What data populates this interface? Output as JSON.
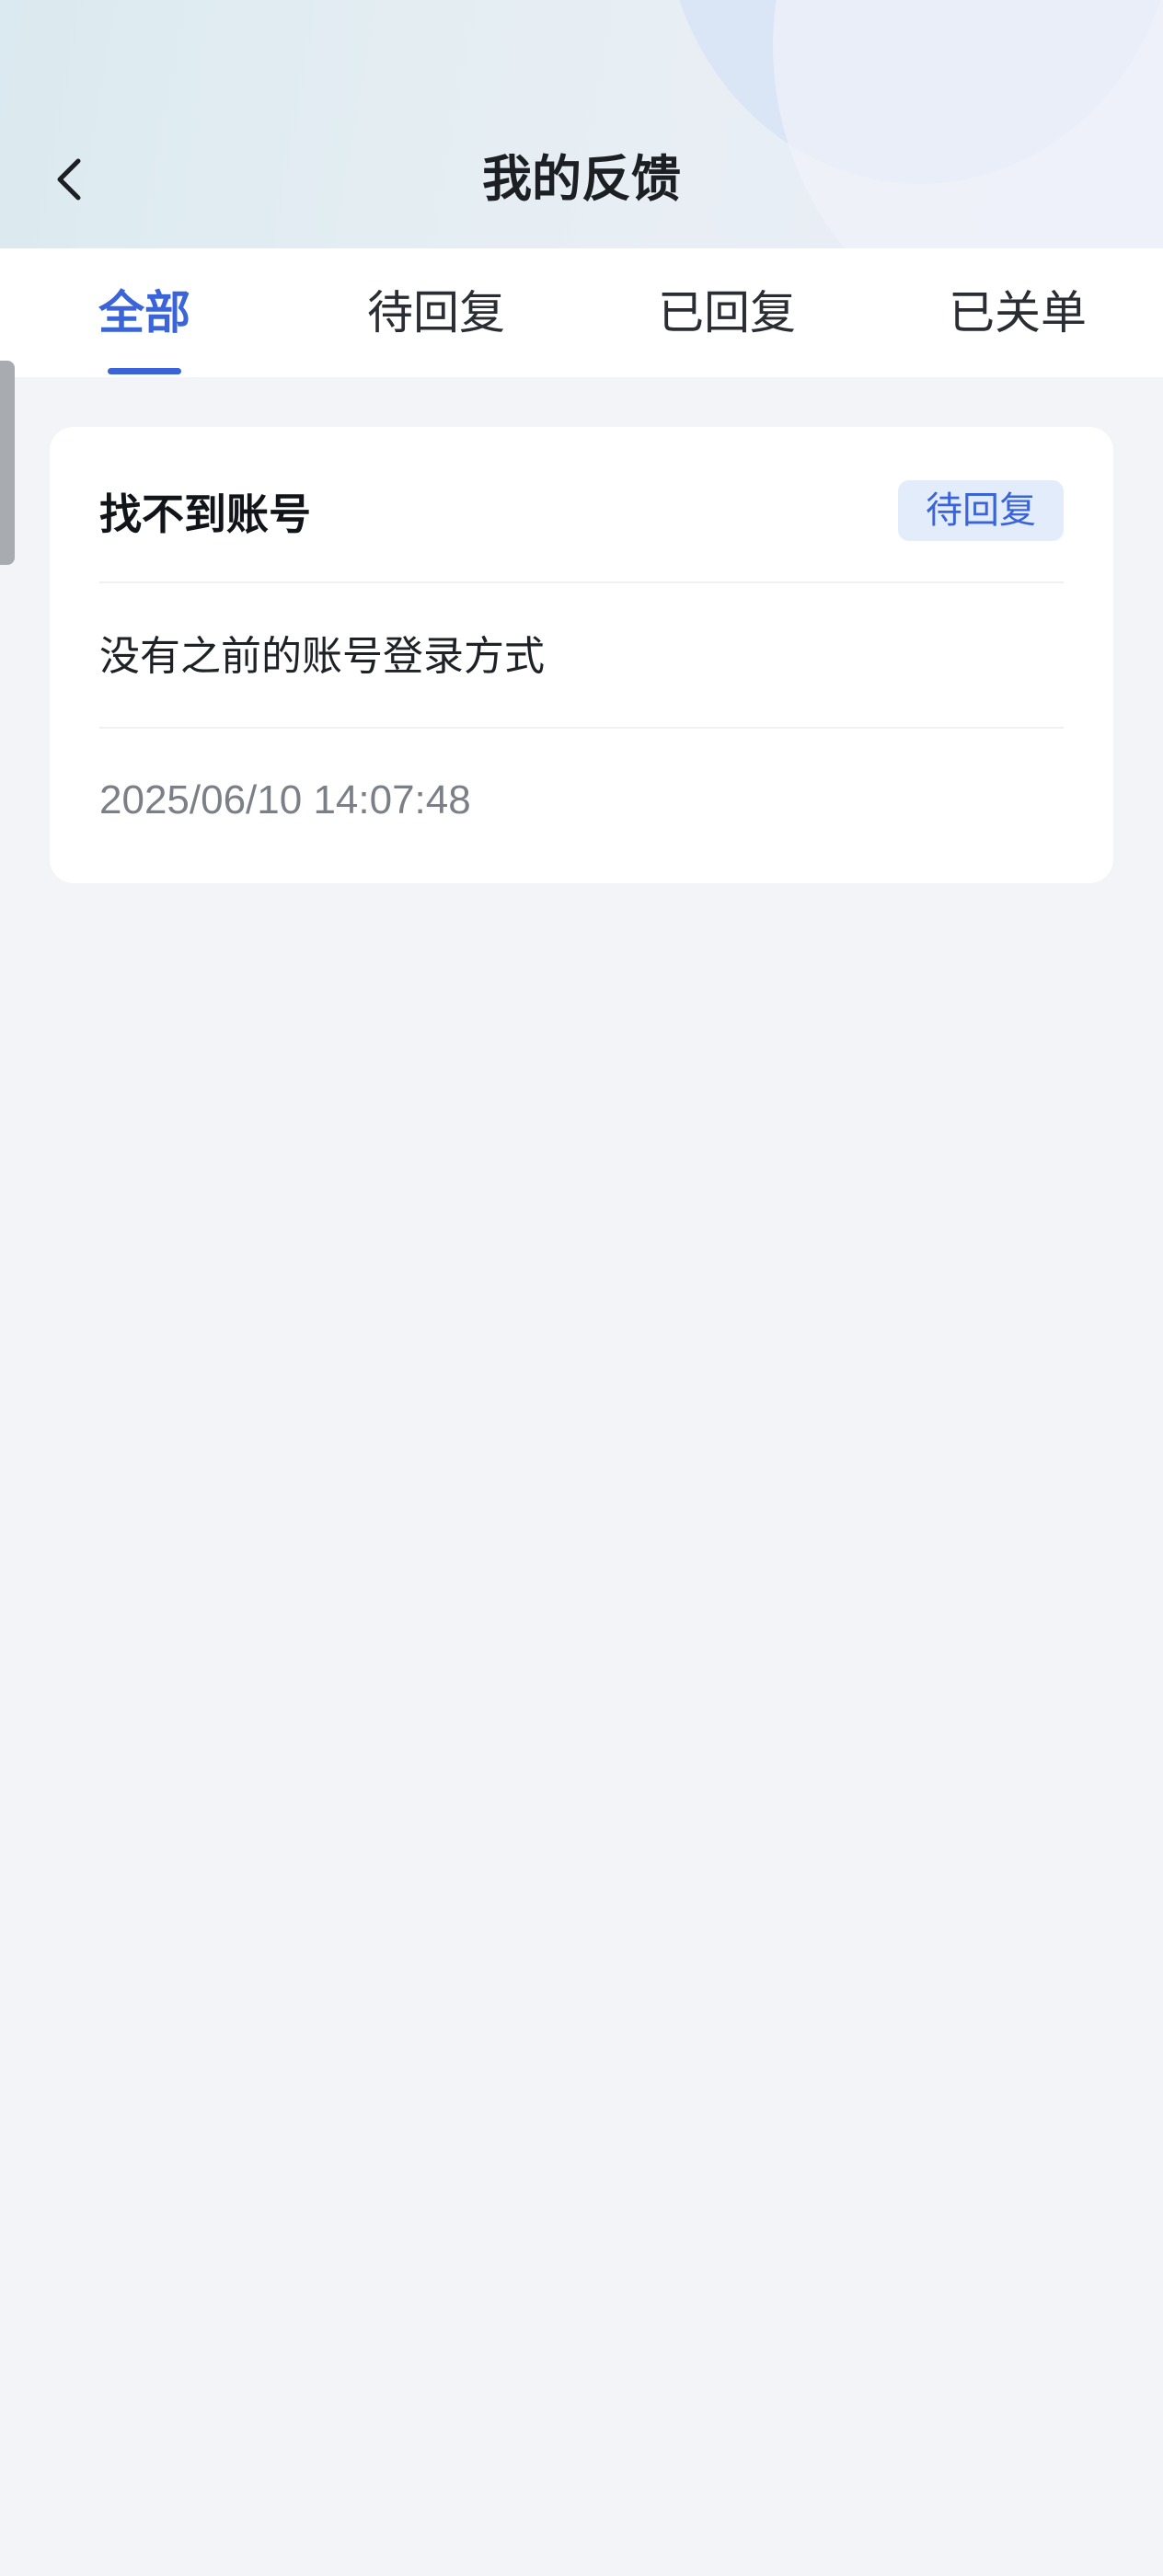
{
  "header": {
    "title": "我的反馈",
    "back_icon": "chevron-left-icon"
  },
  "tabs": [
    {
      "label": "全部",
      "active": true
    },
    {
      "label": "待回复",
      "active": false
    },
    {
      "label": "已回复",
      "active": false
    },
    {
      "label": "已关单",
      "active": false
    }
  ],
  "feedback_list": [
    {
      "title": "找不到账号",
      "status": "待回复",
      "content": "没有之前的账号登录方式",
      "time": "2025/06/10 14:07:48"
    }
  ],
  "colors": {
    "accent": "#3a64d8",
    "badge_bg": "#e3ecfb",
    "page_bg": "#f2f4f7"
  }
}
